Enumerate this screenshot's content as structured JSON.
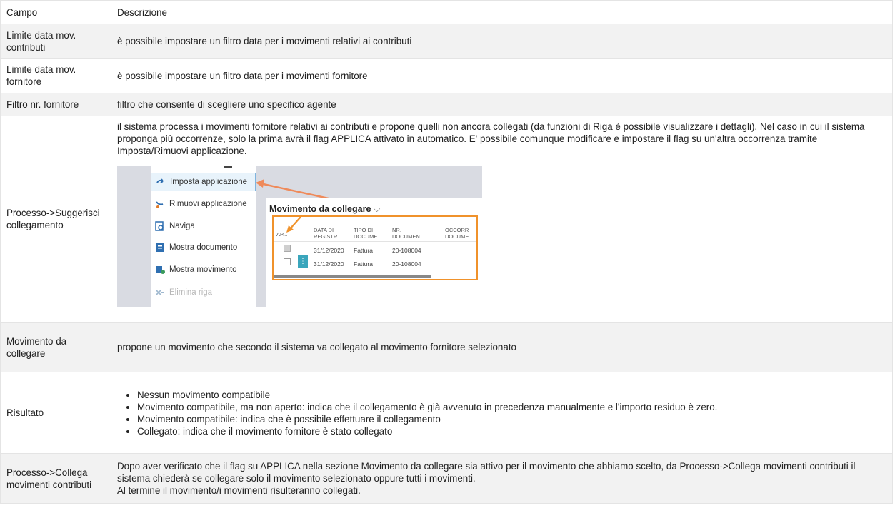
{
  "header": {
    "col1": "Campo",
    "col2": "Descrizione"
  },
  "rows": [
    {
      "field": "Limite data mov. contributi",
      "desc": "è possibile impostare un filtro data per i movimenti relativi ai contributi"
    },
    {
      "field": "Limite data mov. fornitore",
      "desc": "è possibile impostare un filtro data per i movimenti fornitore"
    },
    {
      "field": "Filtro nr. fornitore",
      "desc": "filtro che consente di scegliere uno specifico agente"
    },
    {
      "field": "Processo->Suggerisci collegamento",
      "desc": "il sistema processa i movimenti fornitore relativi ai contributi e propone quelli non ancora collegati (da funzioni di Riga è possibile visualizzare i dettagli). Nel caso in cui il sistema proponga più occorrenze, solo la prima avrà il flag APPLICA attivato in automatico. E' possibile comunque modificare e impostare il flag su un'altra occorrenza tramite Imposta/Rimuovi applicazione."
    },
    {
      "field": "Movimento da collegare",
      "desc": "propone un movimento che secondo il sistema va collegato al movimento fornitore selezionato"
    },
    {
      "field": "Risultato",
      "bullets": [
        "Nessun movimento compatibile",
        "Movimento compatibile, ma non aperto: indica che il collegamento è già avvenuto in precedenza manualmente e l'importo residuo è zero.",
        "Movimento compatibile: indica che è possibile effettuare il collegamento",
        "Collegato: indica che il movimento fornitore è stato collegato"
      ]
    },
    {
      "field": "Processo->Collega movimenti contributi",
      "desc_lines": [
        "Dopo aver verificato che il flag su APPLICA nella sezione Movimento da collegare sia attivo per il movimento che abbiamo scelto, da Processo->Collega movimenti contributi il sistema chiederà se collegare solo il movimento selezionato oppure tutti i movimenti.",
        "Al termine il movimento/i movimenti risulteranno collegati."
      ]
    }
  ],
  "screenshot": {
    "menu": [
      {
        "label": "Imposta applicazione",
        "icon": "arrow-apply-icon",
        "selected": true
      },
      {
        "label": "Rimuovi applicazione",
        "icon": "arrow-remove-icon"
      },
      {
        "label": "Naviga",
        "icon": "navigate-icon"
      },
      {
        "label": "Mostra documento",
        "icon": "document-icon"
      },
      {
        "label": "Mostra movimento",
        "icon": "entry-icon"
      },
      {
        "label": "Elimina riga",
        "icon": "delete-row-icon",
        "disabled": true
      }
    ],
    "panel_title": "Movimento da collegare",
    "columns": [
      "AP...",
      "DATA DI REGISTR...",
      "TIPO DI DOCUME...",
      "NR. DOCUMEN...",
      "OCCORR DOCUME"
    ],
    "grid_rows": [
      {
        "applied": true,
        "date": "31/12/2020",
        "type": "Fattura",
        "nr": "20-108004"
      },
      {
        "applied": false,
        "date": "31/12/2020",
        "type": "Fattura",
        "nr": "20-108004"
      }
    ],
    "accent": "#f0922b"
  }
}
